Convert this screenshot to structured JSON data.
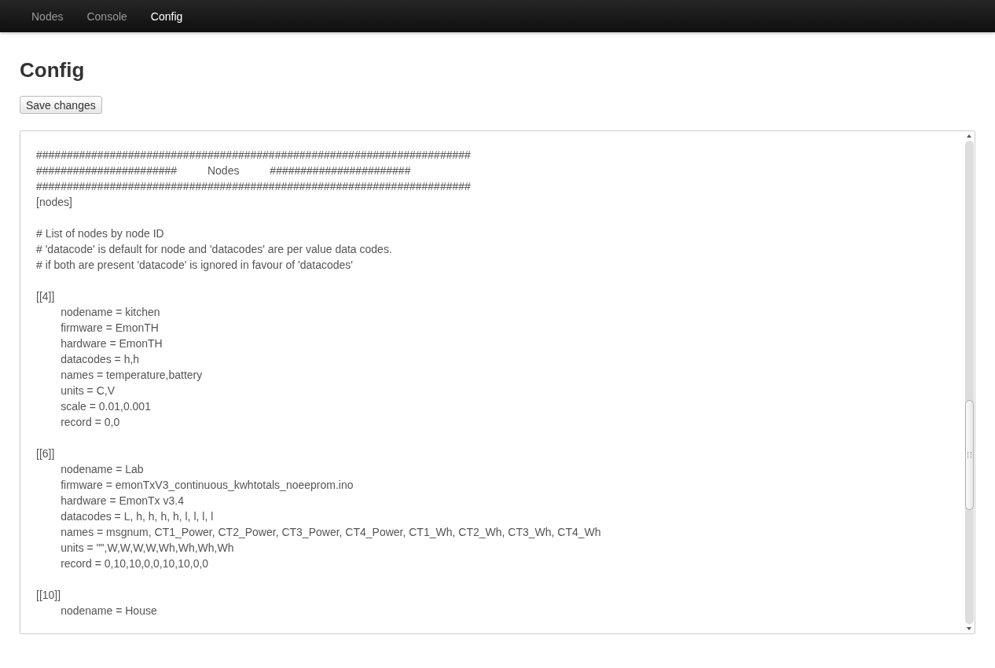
{
  "navbar": {
    "items": [
      {
        "label": "Nodes",
        "selected": false
      },
      {
        "label": "Console",
        "selected": false
      },
      {
        "label": "Config",
        "selected": true
      }
    ]
  },
  "page": {
    "title": "Config",
    "save_button": "Save changes"
  },
  "editor": {
    "blocks": [
      [
        "#######################################################################",
        "#######################          Nodes          #######################",
        "#######################################################################",
        "[nodes]"
      ],
      [
        "# List of nodes by node ID",
        "# 'datacode' is default for node and 'datacodes' are per value data codes.",
        "# if both are present 'datacode' is ignored in favour of 'datacodes'"
      ],
      [
        "[[4]]",
        "\tnodename = kitchen",
        "\tfirmware = EmonTH",
        "\thardware = EmonTH",
        "\tdatacodes = h,h",
        "\tnames = temperature,battery",
        "\tunits = C,V",
        "\tscale = 0.01,0.001",
        "\trecord = 0,0"
      ],
      [
        "[[6]]",
        "\tnodename = Lab",
        "\tfirmware = emonTxV3_continuous_kwhtotals_noeeprom.ino",
        "\thardware = EmonTx v3.4",
        "\tdatacodes = L, h, h, h, h, l, l, l, l",
        "\tnames = msgnum, CT1_Power, CT2_Power, CT3_Power, CT4_Power, CT1_Wh, CT2_Wh, CT3_Wh, CT4_Wh",
        "\tunits = \"\",W,W,W,W,Wh,Wh,Wh,Wh",
        "\trecord = 0,10,10,0,0,10,10,0,0"
      ],
      [
        "[[10]]",
        "\tnodename = House"
      ]
    ]
  }
}
